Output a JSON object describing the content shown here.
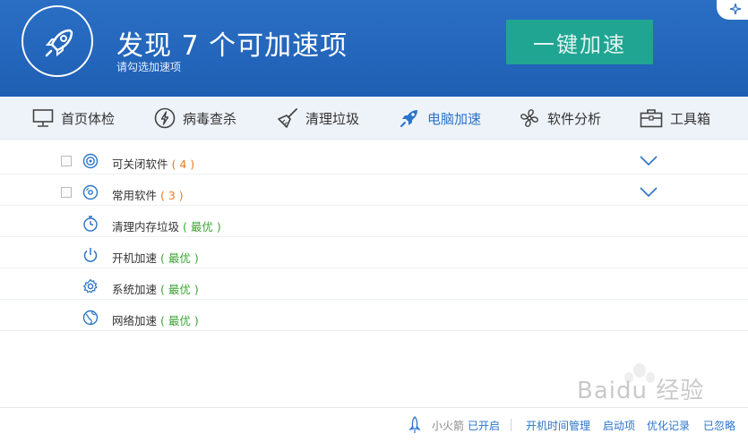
{
  "header": {
    "headline": "发现 7 个可加速项",
    "subline": "请勾选加速项",
    "boost_button": "一键加速",
    "colors": {
      "header_bg": "#2068bd",
      "boost_button_bg": "#1fa592"
    }
  },
  "nav": {
    "items": [
      {
        "label": "首页体检",
        "icon": "monitor-icon"
      },
      {
        "label": "病毒查杀",
        "icon": "lightning-icon"
      },
      {
        "label": "清理垃圾",
        "icon": "broom-icon"
      },
      {
        "label": "电脑加速",
        "icon": "rocket-icon",
        "active": true
      },
      {
        "label": "软件分析",
        "icon": "fan-icon"
      },
      {
        "label": "工具箱",
        "icon": "toolbox-icon"
      }
    ],
    "active_color": "#2a74c9"
  },
  "rows": [
    {
      "label": "可关闭软件",
      "badge": "( 4 )",
      "icon": "disc-icon",
      "checkbox": true,
      "expand": true
    },
    {
      "label": "常用软件",
      "badge": "( 3 )",
      "icon": "cd-icon",
      "checkbox": true,
      "expand": true
    },
    {
      "label": "清理内存垃圾",
      "badge": "( 最优 )",
      "icon": "stopwatch-icon"
    },
    {
      "label": "开机加速",
      "badge": "( 最优 )",
      "icon": "power-icon"
    },
    {
      "label": "系统加速",
      "badge": "( 最优 )",
      "icon": "gear-icon"
    },
    {
      "label": "网络加速",
      "badge": "( 最优 )",
      "icon": "network-icon"
    }
  ],
  "footer": {
    "rocket_label": "小火箭",
    "rocket_status": "已开启",
    "links": [
      "开机时间管理",
      "启动项",
      "优化记录",
      "已忽略"
    ]
  },
  "watermark": {
    "text": "Baidu 经验"
  }
}
